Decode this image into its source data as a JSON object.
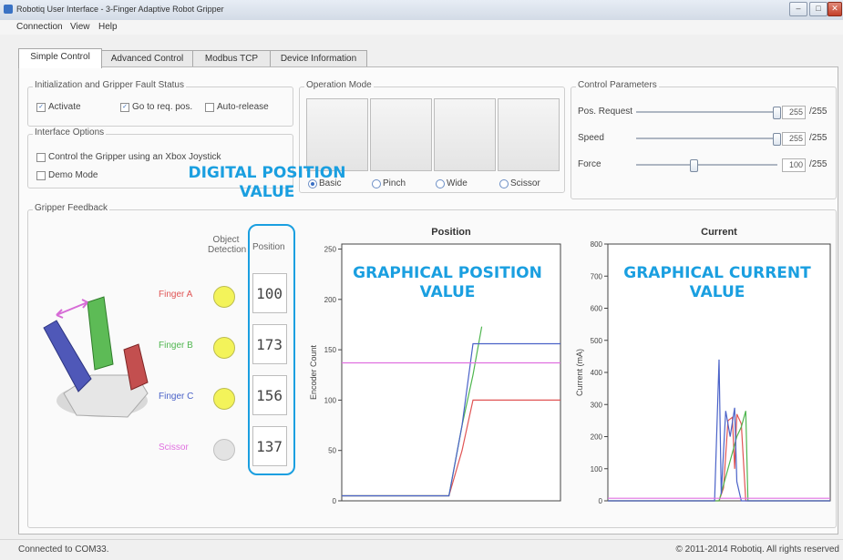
{
  "window": {
    "title": "Robotiq User Interface - 3-Finger Adaptive Robot Gripper"
  },
  "menu": [
    "Connection",
    "View",
    "Help"
  ],
  "tabs": [
    "Simple Control",
    "Advanced Control",
    "Modbus TCP",
    "Device Information"
  ],
  "init": {
    "title": "Initialization and Gripper Fault Status",
    "activate": "Activate",
    "goto": "Go to req. pos.",
    "autorelease": "Auto-release"
  },
  "iface": {
    "title": "Interface Options",
    "xbox": "Control the Gripper using an Xbox Joystick",
    "demo": "Demo Mode"
  },
  "opmode": {
    "title": "Operation Mode",
    "modes": [
      "Basic",
      "Pinch",
      "Wide",
      "Scissor"
    ],
    "selected": "Basic"
  },
  "params": {
    "title": "Control Parameters",
    "rows": [
      {
        "label": "Pos. Request",
        "value": "255",
        "max": "/255",
        "fraction": 1.0
      },
      {
        "label": "Speed",
        "value": "255",
        "max": "/255",
        "fraction": 1.0
      },
      {
        "label": "Force",
        "value": "100",
        "max": "/255",
        "fraction": 0.39
      }
    ]
  },
  "feedback": {
    "title": "Gripper Feedback",
    "col_detection": "Object Detection",
    "col_position": "Position",
    "fingers": [
      {
        "name": "Finger A",
        "color": "#e05555",
        "led": "#f3f35a",
        "position": "100"
      },
      {
        "name": "Finger B",
        "color": "#4fb64f",
        "led": "#f3f35a",
        "position": "173"
      },
      {
        "name": "Finger C",
        "color": "#4a62c8",
        "led": "#f3f35a",
        "position": "156"
      },
      {
        "name": "Scissor",
        "color": "#e070e0",
        "led": "#e3e3e3",
        "position": "137"
      }
    ]
  },
  "callouts": {
    "digital": "DIGITAL POSITION VALUE",
    "graph_pos": "GRAPHICAL POSITION VALUE",
    "graph_cur": "GRAPHICAL CURRENT VALUE"
  },
  "chart_data": [
    {
      "type": "line",
      "title": "Position",
      "ylabel": "Encoder Count",
      "ylim": [
        0,
        255
      ],
      "yticks": [
        0,
        50,
        100,
        150,
        200,
        250
      ],
      "xlim": [
        0,
        100
      ],
      "series": [
        {
          "name": "Finger A",
          "color": "#e05555",
          "points": [
            [
              0,
              5
            ],
            [
              49,
              5
            ],
            [
              55,
              50
            ],
            [
              60,
              100
            ],
            [
              100,
              100
            ]
          ]
        },
        {
          "name": "Finger B",
          "color": "#4fb64f",
          "points": [
            [
              0,
              5
            ],
            [
              49,
              5
            ],
            [
              55,
              75
            ],
            [
              60,
              125
            ],
            [
              64,
              173
            ]
          ]
        },
        {
          "name": "Finger C",
          "color": "#4a62c8",
          "points": [
            [
              0,
              5
            ],
            [
              49,
              5
            ],
            [
              55,
              75
            ],
            [
              60,
              156
            ],
            [
              100,
              156
            ]
          ]
        },
        {
          "name": "Scissor",
          "color": "#e070e0",
          "points": [
            [
              0,
              137
            ],
            [
              100,
              137
            ]
          ]
        }
      ]
    },
    {
      "type": "line",
      "title": "Current",
      "ylabel": "Current (mA)",
      "ylim": [
        0,
        800
      ],
      "yticks": [
        0,
        100,
        200,
        300,
        400,
        500,
        600,
        700,
        800
      ],
      "xlim": [
        0,
        100
      ],
      "series": [
        {
          "name": "Finger A",
          "color": "#e05555",
          "points": [
            [
              0,
              0
            ],
            [
              50,
              0
            ],
            [
              52,
              40
            ],
            [
              54,
              250
            ],
            [
              56,
              260
            ],
            [
              57,
              100
            ],
            [
              58,
              270
            ],
            [
              60,
              240
            ],
            [
              62,
              0
            ],
            [
              100,
              0
            ]
          ]
        },
        {
          "name": "Finger B",
          "color": "#4fb64f",
          "points": [
            [
              0,
              0
            ],
            [
              50,
              0
            ],
            [
              54,
              100
            ],
            [
              58,
              200
            ],
            [
              60,
              230
            ],
            [
              62,
              280
            ],
            [
              63,
              0
            ],
            [
              100,
              0
            ]
          ]
        },
        {
          "name": "Finger C",
          "color": "#4a62c8",
          "points": [
            [
              0,
              0
            ],
            [
              48,
              0
            ],
            [
              50,
              440
            ],
            [
              51,
              20
            ],
            [
              53,
              280
            ],
            [
              55,
              200
            ],
            [
              57,
              290
            ],
            [
              58,
              60
            ],
            [
              60,
              0
            ],
            [
              100,
              0
            ]
          ]
        },
        {
          "name": "Scissor",
          "color": "#e070e0",
          "points": [
            [
              0,
              8
            ],
            [
              100,
              8
            ]
          ]
        }
      ]
    }
  ],
  "status": {
    "left": "Connected to COM33.",
    "right": "© 2011-2014 Robotiq. All rights reserved"
  }
}
